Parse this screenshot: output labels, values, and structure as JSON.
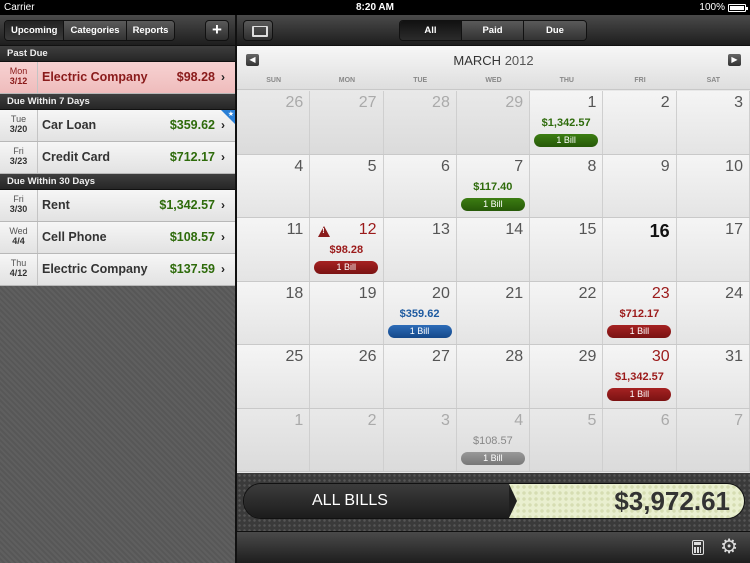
{
  "status": {
    "carrier": "Carrier",
    "time": "8:20 AM",
    "battery": "100%"
  },
  "left": {
    "tabs": [
      "Upcoming",
      "Categories",
      "Reports"
    ],
    "add_label": "+",
    "sections": [
      {
        "title": "Past Due",
        "rows": [
          {
            "weekday": "Mon",
            "date": "3/12",
            "name": "Electric Company",
            "amount": "$98.28"
          }
        ]
      },
      {
        "title": "Due Within 7 Days",
        "rows": [
          {
            "weekday": "Tue",
            "date": "3/20",
            "name": "Car Loan",
            "amount": "$359.62"
          },
          {
            "weekday": "Fri",
            "date": "3/23",
            "name": "Credit Card",
            "amount": "$712.17"
          }
        ]
      },
      {
        "title": "Due Within 30 Days",
        "rows": [
          {
            "weekday": "Fri",
            "date": "3/30",
            "name": "Rent",
            "amount": "$1,342.57"
          },
          {
            "weekday": "Wed",
            "date": "4/4",
            "name": "Cell Phone",
            "amount": "$108.57"
          },
          {
            "weekday": "Thu",
            "date": "4/12",
            "name": "Electric Company",
            "amount": "$137.59"
          }
        ]
      }
    ]
  },
  "right": {
    "filters": [
      "All",
      "Paid",
      "Due"
    ],
    "month": "MARCH",
    "year": "2012",
    "weekdays": [
      "SUN",
      "MON",
      "TUE",
      "WED",
      "THU",
      "FRI",
      "SAT"
    ],
    "weeks": [
      [
        {
          "n": "26",
          "out": true
        },
        {
          "n": "27",
          "out": true
        },
        {
          "n": "28",
          "out": true
        },
        {
          "n": "29",
          "out": true
        },
        {
          "n": "1",
          "amt": "$1,342.57",
          "bill": "1 Bill",
          "c": "g"
        },
        {
          "n": "2"
        },
        {
          "n": "3"
        }
      ],
      [
        {
          "n": "4"
        },
        {
          "n": "5"
        },
        {
          "n": "6"
        },
        {
          "n": "7",
          "amt": "$117.40",
          "bill": "1 Bill",
          "c": "g"
        },
        {
          "n": "8"
        },
        {
          "n": "9"
        },
        {
          "n": "10"
        }
      ],
      [
        {
          "n": "11"
        },
        {
          "n": "12",
          "amt": "$98.28",
          "bill": "1 Bill",
          "c": "r",
          "warn": true,
          "red": true
        },
        {
          "n": "13"
        },
        {
          "n": "14"
        },
        {
          "n": "15"
        },
        {
          "n": "16",
          "today": true
        },
        {
          "n": "17"
        }
      ],
      [
        {
          "n": "18"
        },
        {
          "n": "19"
        },
        {
          "n": "20",
          "amt": "$359.62",
          "bill": "1 Bill",
          "c": "b"
        },
        {
          "n": "21"
        },
        {
          "n": "22"
        },
        {
          "n": "23",
          "amt": "$712.17",
          "bill": "1 Bill",
          "c": "r",
          "red": true
        },
        {
          "n": "24"
        }
      ],
      [
        {
          "n": "25"
        },
        {
          "n": "26"
        },
        {
          "n": "27"
        },
        {
          "n": "28"
        },
        {
          "n": "29"
        },
        {
          "n": "30",
          "amt": "$1,342.57",
          "bill": "1 Bill",
          "c": "r",
          "red": true
        },
        {
          "n": "31"
        }
      ],
      [
        {
          "n": "1",
          "out": true
        },
        {
          "n": "2",
          "out": true
        },
        {
          "n": "3",
          "out": true
        },
        {
          "n": "4",
          "out": true,
          "amt": "$108.57",
          "bill": "1 Bill",
          "c": "gr"
        },
        {
          "n": "5",
          "out": true
        },
        {
          "n": "6",
          "out": true
        },
        {
          "n": "7",
          "out": true
        }
      ]
    ],
    "total_label": "ALL BILLS",
    "total_value": "$3,972.61"
  }
}
